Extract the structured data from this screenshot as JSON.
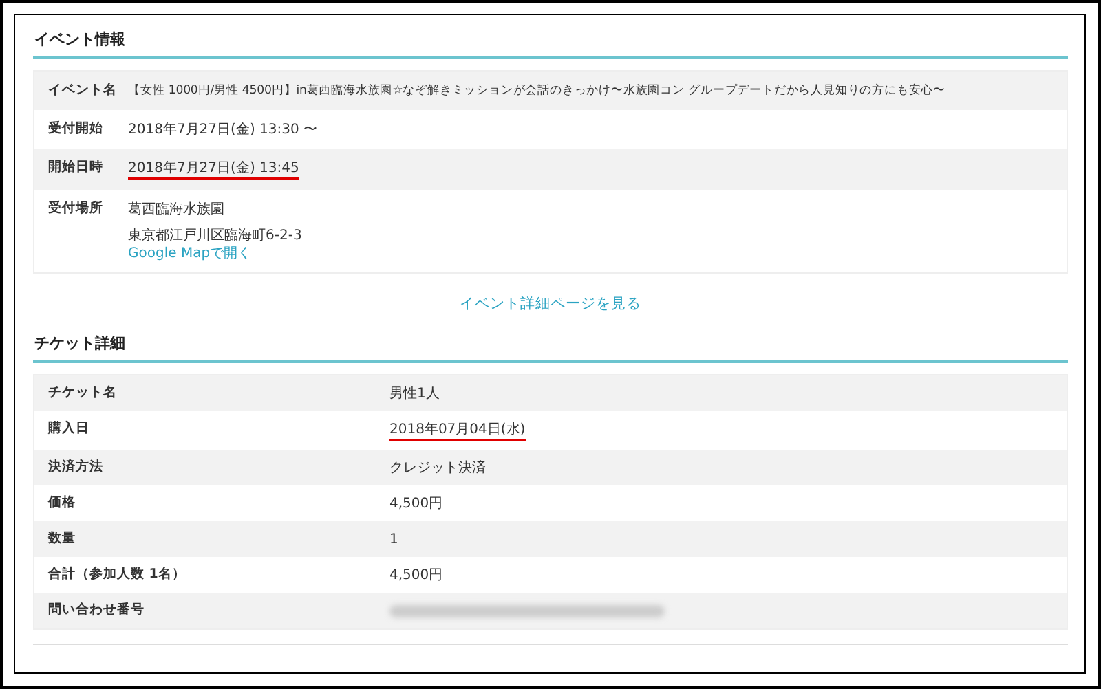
{
  "event_info": {
    "heading": "イベント情報",
    "rows": [
      {
        "label": "イベント名",
        "lines": [
          {
            "kind": "text",
            "text": "【女性 1000円/男性 4500円】in葛西臨海水族園☆なぞ解きミッションが会話のきっかけ〜水族園コン グループデートだから人見知りの方にも安心〜"
          }
        ],
        "underlined": false
      },
      {
        "label": "受付開始",
        "lines": [
          {
            "kind": "text",
            "text": "2018年7月27日(金) 13:30 〜"
          }
        ],
        "underlined": false
      },
      {
        "label": "開始日時",
        "lines": [
          {
            "kind": "text",
            "text": "2018年7月27日(金) 13:45"
          }
        ],
        "underlined": true
      },
      {
        "label": "受付場所",
        "lines": [
          {
            "kind": "text",
            "text": "葛西臨海水族園"
          },
          {
            "kind": "gap"
          },
          {
            "kind": "text",
            "text": "東京都江戸川区臨海町6-2-3"
          },
          {
            "kind": "link",
            "text": "Google Mapで開く"
          }
        ],
        "underlined": false
      }
    ],
    "detail_link": "イベント詳細ページを見る"
  },
  "ticket_details": {
    "heading": "チケット詳細",
    "rows": [
      {
        "label": "チケット名",
        "kind": "text",
        "value": "男性1人",
        "underlined": false
      },
      {
        "label": "購入日",
        "kind": "text",
        "value": "2018年07月04日(水)",
        "underlined": true
      },
      {
        "label": "決済方法",
        "kind": "text",
        "value": "クレジット決済",
        "underlined": false
      },
      {
        "label": "価格",
        "kind": "text",
        "value": "4,500円",
        "underlined": false
      },
      {
        "label": "数量",
        "kind": "text",
        "value": "1",
        "underlined": false
      },
      {
        "label": "合計（参加人数 1名）",
        "kind": "text",
        "value": "4,500円",
        "underlined": false
      },
      {
        "label": "問い合わせ番号",
        "kind": "redacted",
        "underlined": false
      }
    ]
  }
}
